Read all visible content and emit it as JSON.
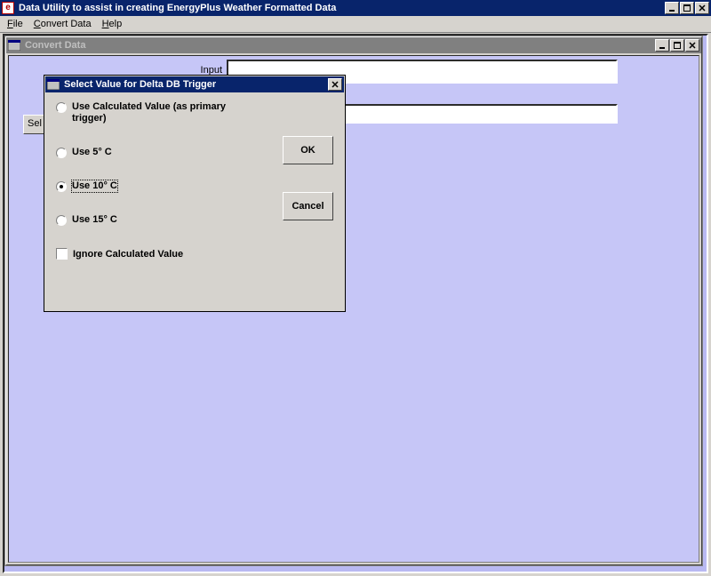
{
  "main_window": {
    "title": "Data Utility to assist in creating EnergyPlus Weather Formatted Data",
    "menu": {
      "file": "File",
      "convert_data": "Convert Data",
      "help": "Help"
    }
  },
  "child_window": {
    "title": "Convert Data",
    "labels": {
      "input": "Input"
    },
    "sel_button": "Sel",
    "input1_value": "",
    "input2_value": ""
  },
  "dialog": {
    "title": "Select Value for Delta DB Trigger",
    "options": {
      "calc": "Use Calculated Value (as primary trigger)",
      "use5": "Use 5° C",
      "use10": "Use 10° C",
      "use15": "Use 15° C"
    },
    "selected": "use10",
    "checkbox": "Ignore Calculated Value",
    "checkbox_checked": false,
    "buttons": {
      "ok": "OK",
      "cancel": "Cancel"
    }
  }
}
